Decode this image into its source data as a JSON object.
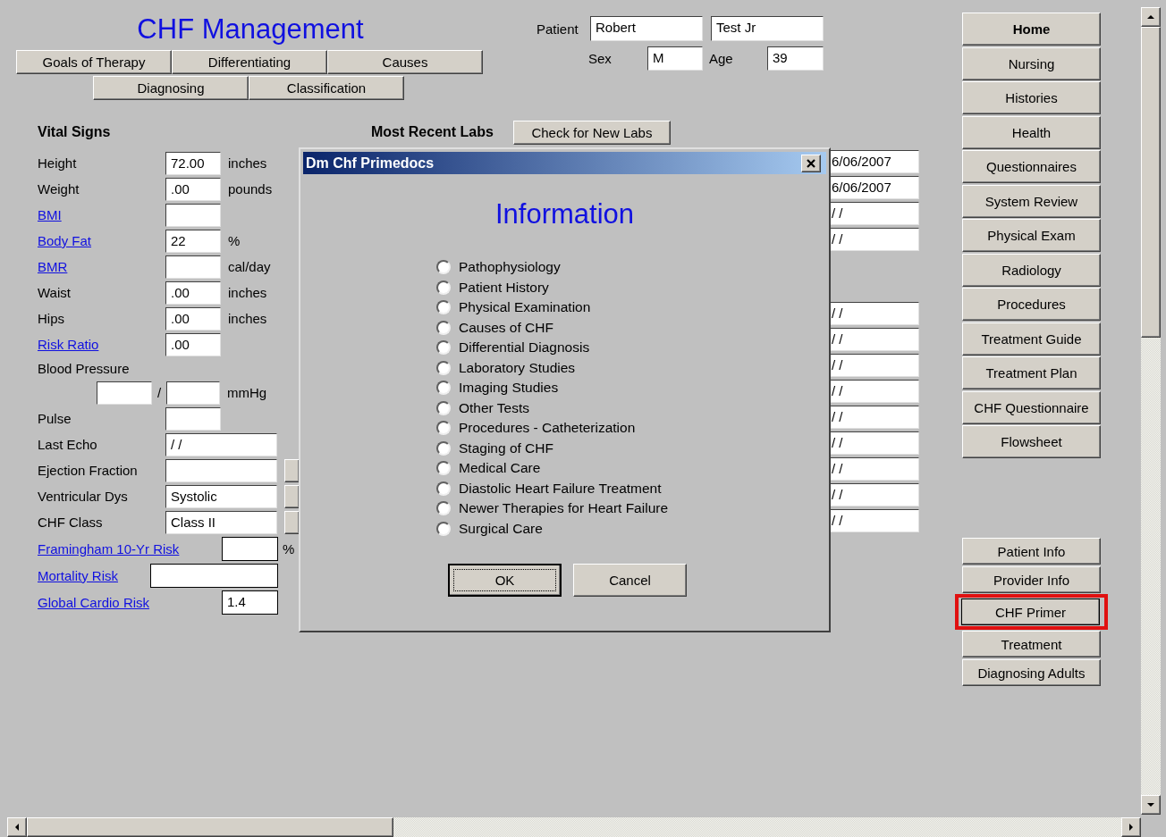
{
  "title": "CHF Management",
  "section_buttons": [
    [
      "Goals of Therapy",
      "Differentiating",
      "Causes"
    ],
    [
      "Diagnosing",
      "Classification"
    ]
  ],
  "patient": {
    "label": "Patient",
    "first_name": "Robert",
    "last_name": "Test Jr",
    "sex_label": "Sex",
    "sex": "M",
    "age_label": "Age",
    "age": "39"
  },
  "vital_signs": {
    "heading": "Vital Signs",
    "rows": [
      {
        "kind": "measure",
        "label": "Height",
        "link": false,
        "value": "72.00",
        "unit": "inches"
      },
      {
        "kind": "measure",
        "label": "Weight",
        "link": false,
        "value": ".00",
        "unit": "pounds"
      },
      {
        "kind": "measure",
        "label": "BMI",
        "link": true,
        "value": ""
      },
      {
        "kind": "measure",
        "label": "Body Fat",
        "link": true,
        "value": "22",
        "unit": "%"
      },
      {
        "kind": "measure",
        "label": "BMR",
        "link": true,
        "value": "",
        "unit": "cal/day"
      },
      {
        "kind": "measure",
        "label": "Waist",
        "link": false,
        "value": ".00",
        "unit": "inches"
      },
      {
        "kind": "measure",
        "label": "Hips",
        "link": false,
        "value": ".00",
        "unit": "inches"
      },
      {
        "kind": "measure",
        "label": "Risk Ratio",
        "link": true,
        "value": ".00"
      },
      {
        "kind": "heading",
        "label": "Blood Pressure",
        "link": false
      },
      {
        "kind": "pressure",
        "separator": "/",
        "unit": "mmHg"
      },
      {
        "kind": "measure",
        "label": "Pulse",
        "link": false,
        "value": ""
      },
      {
        "kind": "wide",
        "label": "Last Echo",
        "link": false,
        "value": "/ /"
      },
      {
        "kind": "wide_button",
        "label": "Ejection Fraction",
        "link": false,
        "value": ""
      },
      {
        "kind": "wide_button",
        "label": "Ventricular Dys",
        "link": false,
        "value": "Systolic"
      },
      {
        "kind": "wide_button",
        "label": "CHF Class",
        "link": false,
        "value": "Class II"
      },
      {
        "kind": "risk",
        "label": "Framingham 10-Yr Risk",
        "link": true,
        "value": "",
        "unit": "%"
      },
      {
        "kind": "risk_long",
        "label": "Mortality Risk",
        "link": true,
        "value": ""
      },
      {
        "kind": "risk",
        "label": "Global Cardio Risk",
        "link": true,
        "value": "1.4"
      }
    ]
  },
  "labs": {
    "heading": "Most Recent Labs",
    "check_button": "Check for New Labs",
    "date_groups": [
      [
        "6/06/2007",
        "6/06/2007",
        "/ /",
        "/ /"
      ],
      [
        "/ /",
        "/ /",
        "/ /",
        "/ /",
        "/ /",
        "/ /",
        "/ /",
        "/ /",
        "/ /"
      ]
    ]
  },
  "nav_primary": [
    {
      "label": "Home",
      "bold": true
    },
    {
      "label": "Nursing",
      "bold": false
    },
    {
      "label": "Histories",
      "bold": false
    },
    {
      "label": "Health",
      "bold": false
    },
    {
      "label": "Questionnaires",
      "bold": false
    },
    {
      "label": "System Review",
      "bold": false
    },
    {
      "label": "Physical Exam",
      "bold": false
    },
    {
      "label": "Radiology",
      "bold": false
    },
    {
      "label": "Procedures",
      "bold": false
    },
    {
      "label": "Treatment Guide",
      "bold": false
    },
    {
      "label": "Treatment Plan",
      "bold": false
    },
    {
      "label": "CHF Questionnaire",
      "bold": false
    },
    {
      "label": "Flowsheet",
      "bold": false
    }
  ],
  "nav_secondary": [
    {
      "label": "Patient Info",
      "highlighted": false
    },
    {
      "label": "Provider Info",
      "highlighted": false
    },
    {
      "label": "CHF Primer",
      "highlighted": true
    },
    {
      "label": "Treatment",
      "highlighted": false
    },
    {
      "label": "Diagnosing Adults",
      "highlighted": false
    }
  ],
  "dialog": {
    "title": "Dm Chf Primedocs",
    "heading": "Information",
    "options": [
      {
        "label": "Pathophysiology",
        "selected": false
      },
      {
        "label": "Patient History",
        "selected": false
      },
      {
        "label": "Physical Examination",
        "selected": false
      },
      {
        "label": "Causes of CHF",
        "selected": false
      },
      {
        "label": "Differential Diagnosis",
        "selected": false
      },
      {
        "label": "Laboratory Studies",
        "selected": false
      },
      {
        "label": "Imaging Studies",
        "selected": false
      },
      {
        "label": "Other Tests",
        "selected": false
      },
      {
        "label": "Procedures - Catheterization",
        "selected": false
      },
      {
        "label": "Staging of CHF",
        "selected": false
      },
      {
        "label": "Medical Care",
        "selected": false
      },
      {
        "label": "Diastolic Heart Failure Treatment",
        "selected": false
      },
      {
        "label": "Newer Therapies for Heart Failure",
        "selected": false
      },
      {
        "label": "Surgical Care",
        "selected": false
      }
    ],
    "buttons": [
      {
        "label": "OK",
        "default": true
      },
      {
        "label": "Cancel",
        "default": false
      }
    ]
  }
}
